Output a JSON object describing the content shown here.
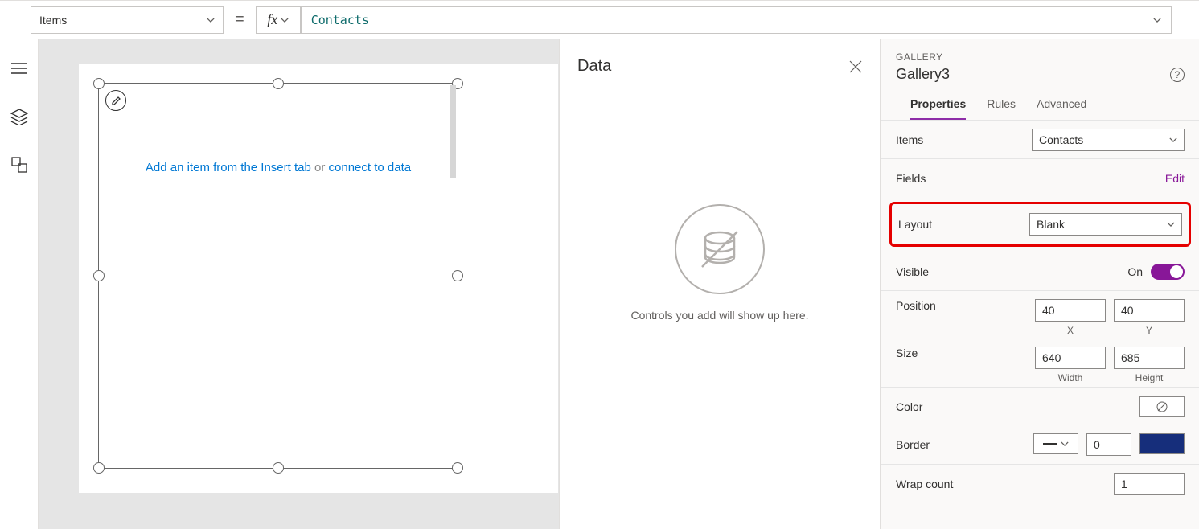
{
  "formulaBar": {
    "propertyName": "Items",
    "equals": "=",
    "fx": "fx",
    "formula": "Contacts"
  },
  "canvas": {
    "hint": {
      "insertPart": "Add an item from the Insert tab",
      "or": " or ",
      "connectPart": "connect to data"
    }
  },
  "dataPanel": {
    "title": "Data",
    "emptyMessage": "Controls you add will show up here."
  },
  "propsPanel": {
    "typeLabel": "GALLERY",
    "name": "Gallery3",
    "tabs": {
      "properties": "Properties",
      "rules": "Rules",
      "advanced": "Advanced"
    },
    "items": {
      "label": "Items",
      "value": "Contacts"
    },
    "fields": {
      "label": "Fields",
      "editLink": "Edit"
    },
    "layout": {
      "label": "Layout",
      "value": "Blank"
    },
    "visible": {
      "label": "Visible",
      "onText": "On"
    },
    "position": {
      "label": "Position",
      "x": "40",
      "y": "40",
      "xLabel": "X",
      "yLabel": "Y"
    },
    "size": {
      "label": "Size",
      "w": "640",
      "h": "685",
      "wLabel": "Width",
      "hLabel": "Height"
    },
    "color": {
      "label": "Color"
    },
    "border": {
      "label": "Border",
      "value": "0"
    },
    "wrap": {
      "label": "Wrap count",
      "value": "1"
    }
  }
}
